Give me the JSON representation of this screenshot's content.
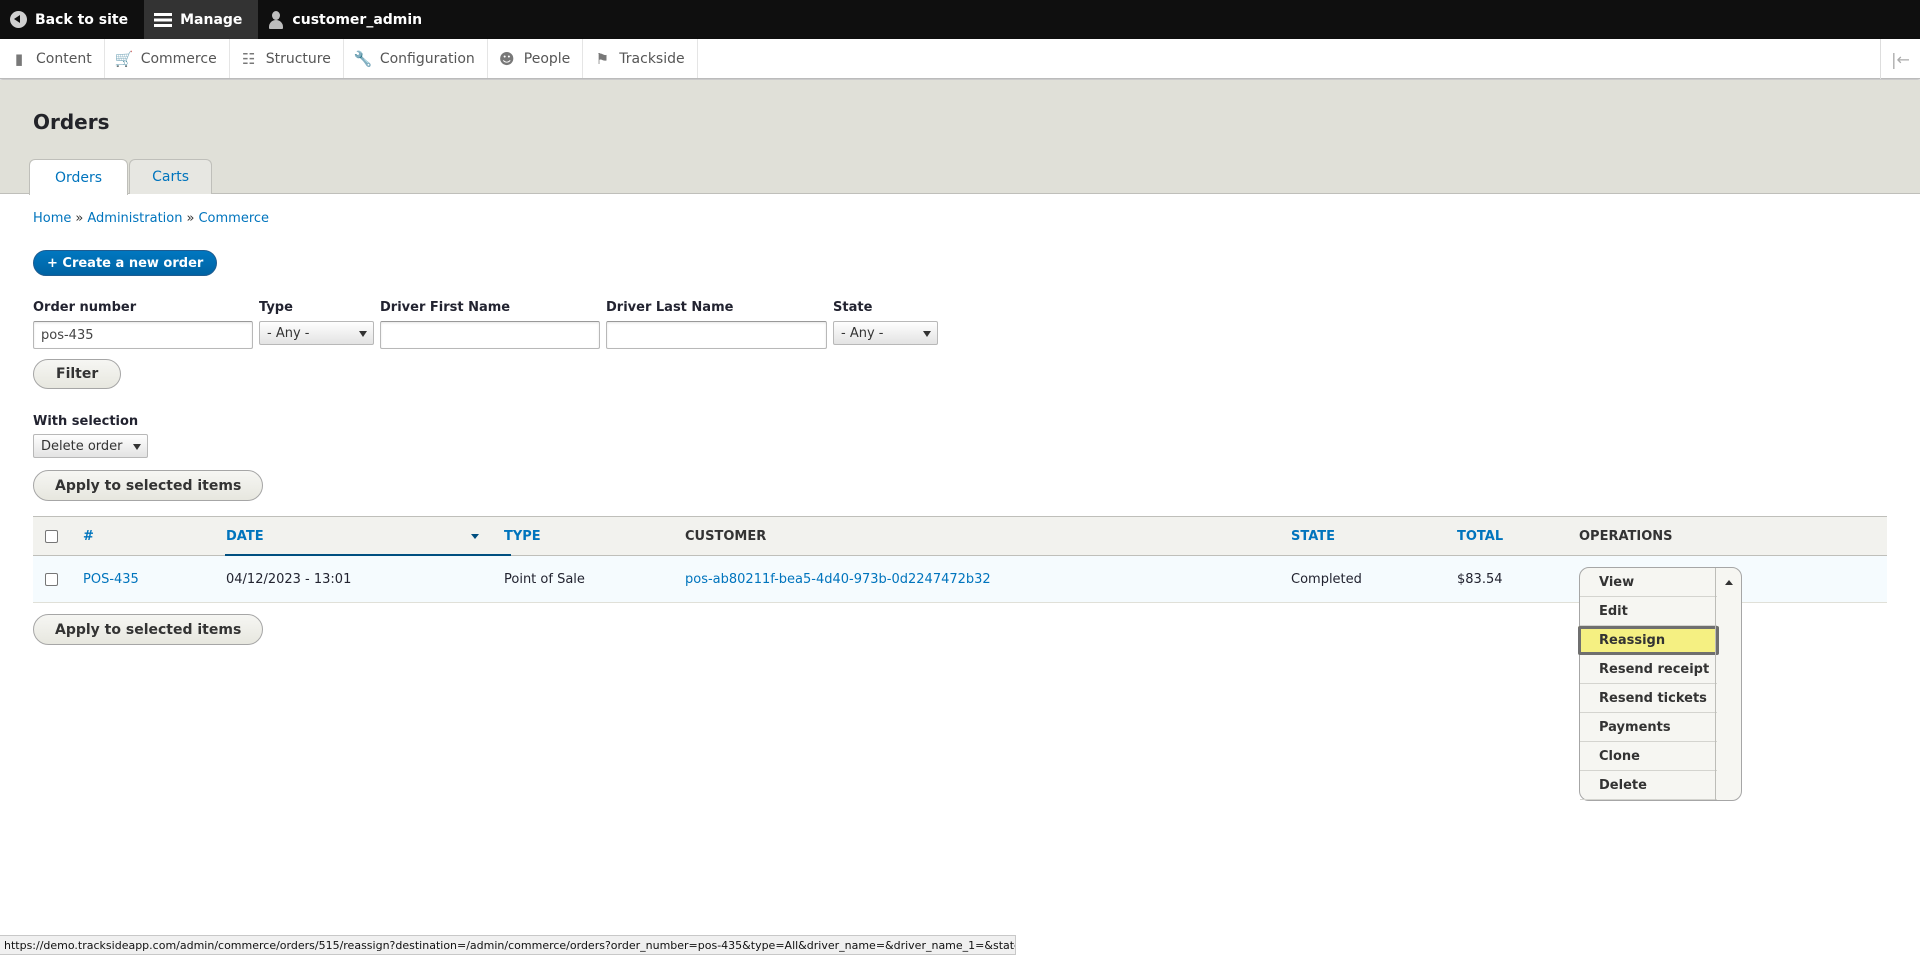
{
  "toolbar": {
    "back_label": "Back to site",
    "manage_label": "Manage",
    "user_label": "customer_admin"
  },
  "tray": {
    "items": [
      {
        "label": "Content",
        "icon": "document-icon"
      },
      {
        "label": "Commerce",
        "icon": "cart-icon"
      },
      {
        "label": "Structure",
        "icon": "sitemap-icon"
      },
      {
        "label": "Configuration",
        "icon": "wrench-icon"
      },
      {
        "label": "People",
        "icon": "people-icon"
      },
      {
        "label": "Trackside",
        "icon": "checkered-flag-icon"
      }
    ]
  },
  "page": {
    "title": "Orders",
    "tabs": [
      "Orders",
      "Carts"
    ]
  },
  "breadcrumb": [
    "Home",
    "Administration",
    "Commerce"
  ],
  "breadcrumb_sep": "»",
  "create_button": "+ Create a new order",
  "filters": {
    "order_number": {
      "label": "Order number",
      "value": "pos-435"
    },
    "type": {
      "label": "Type",
      "value": "- Any -"
    },
    "driver_first": {
      "label": "Driver First Name",
      "value": ""
    },
    "driver_last": {
      "label": "Driver Last Name",
      "value": ""
    },
    "state": {
      "label": "State",
      "value": "- Any -"
    },
    "filter_button": "Filter"
  },
  "bulk": {
    "label": "With selection",
    "action": "Delete order",
    "apply_button": "Apply to selected items"
  },
  "table": {
    "headers": {
      "number": "#",
      "date": "Date",
      "type": "Type",
      "customer": "Customer",
      "state": "State",
      "total": "Total",
      "operations": "Operations"
    },
    "rows": [
      {
        "number": "POS-435",
        "date": "04/12/2023 - 13:01",
        "type": "Point of Sale",
        "customer": "pos-ab80211f-bea5-4d40-973b-0d2247472b32",
        "state": "Completed",
        "total": "$83.54"
      }
    ]
  },
  "operations": [
    "View",
    "Edit",
    "Reassign",
    "Resend receipt",
    "Resend tickets",
    "Payments",
    "Clone",
    "Delete"
  ],
  "status_url": "https://demo.tracksideapp.com/admin/commerce/orders/515/reassign?destination=/admin/commerce/orders?order_number=pos-435&type=All&driver_name=&driver_name_1=&state=All"
}
